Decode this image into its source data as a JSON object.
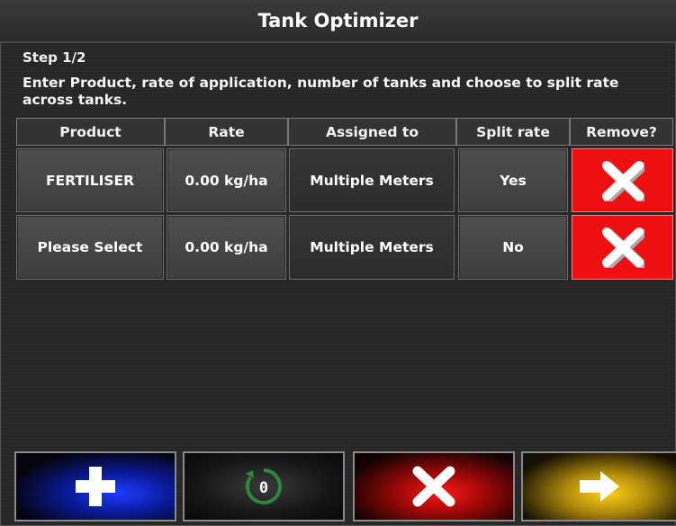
{
  "window": {
    "title": "Tank Optimizer"
  },
  "step_label": "Step 1/2",
  "instructions": "Enter Product, rate of application, number of tanks and choose to split rate across tanks.",
  "table": {
    "headers": [
      "Product",
      "Rate",
      "Assigned to",
      "Split rate",
      "Remove?"
    ],
    "rows": [
      {
        "product": "FERTILISER",
        "rate": "0.00 kg/ha",
        "assigned_to": "Multiple Meters",
        "split_rate": "Yes",
        "remove_icon": "close-icon"
      },
      {
        "product": "Please Select",
        "rate": "0.00 kg/ha",
        "assigned_to": "Multiple Meters",
        "split_rate": "No",
        "remove_icon": "close-icon"
      }
    ]
  },
  "bottom_bar": {
    "add": {
      "icon": "plus-icon",
      "color": "#1e3cff"
    },
    "reset": {
      "icon": "reset-icon",
      "label": "0",
      "color": "#2a8a3a"
    },
    "cancel": {
      "icon": "close-icon",
      "color": "#ff1818"
    },
    "next": {
      "icon": "arrow-right-icon",
      "color": "#ffd21a"
    }
  },
  "colors": {
    "remove_bg": "#ee1010",
    "accent_green": "#2a8a3a"
  }
}
